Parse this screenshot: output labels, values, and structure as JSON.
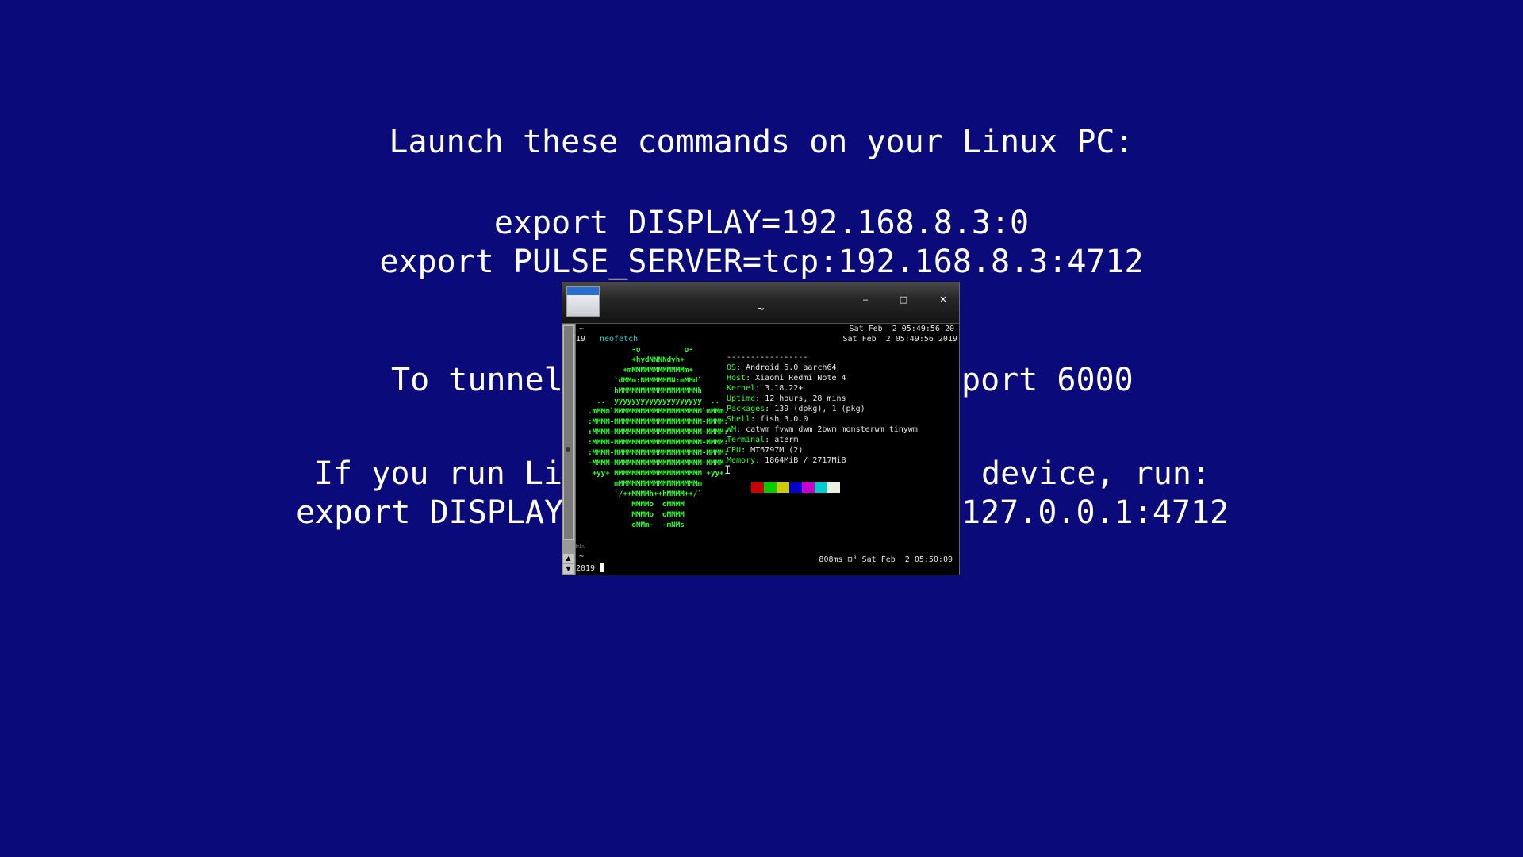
{
  "background": {
    "color": "#0a0a7a",
    "lines": [
      "Launch these commands on your Linux PC:",
      "export DISPLAY=192.168.8.3:0",
      "export PULSE_SERVER=tcp:192.168.8.3:4712",
      "To tunnel",
      "port 6000",
      "If you run Li",
      "device, run:",
      "export DISPLAY",
      "127.0.0.1:4712"
    ]
  },
  "window": {
    "title": "~",
    "buttons": {
      "minimize": "‒",
      "maximize": "□",
      "close": "✕"
    },
    "scroll_up": "▲",
    "scroll_down": "▼"
  },
  "terminal": {
    "prompt1_dir": "~",
    "prompt1_num": "19",
    "prompt1_cmd": "neofetch",
    "right_time1": "Sat Feb  2 05:49:56 20",
    "right_time2": "Sat Feb  2 05:49:56 2019",
    "ascii_art": "            -o          o-\n            +hydNNNNdyh+\n          +mMMMMMMMMMMMMm+\n        `dMMm:NMMMMMMN:mMMd`\n        hMMMMMMMMMMMMMMMMMMh\n    ..  yyyyyyyyyyyyyyyyyyyy  ..\n  .mMMm`MMMMMMMMMMMMMMMMMMMM`mMMm.\n  :MMMM-MMMMMMMMMMMMMMMMMMMM-MMMM:\n  :MMMM-MMMMMMMMMMMMMMMMMMMM-MMMM:\n  :MMMM-MMMMMMMMMMMMMMMMMMMM-MMMM:\n  :MMMM-MMMMMMMMMMMMMMMMMMMM-MMMM:\n  -MMMM-MMMMMMMMMMMMMMMMMMMM-MMMM-\n   +yy+ MMMMMMMMMMMMMMMMMMMM +yy+\n        mMMMMMMMMMMMMMMMMMMm\n        `/++MMMMh++hMMMM++/`\n            MMMMo  oMMMM\n            MMMMo  oMMMM\n            oNMm-  -mNMs",
    "info_separator": "-----------------",
    "info": [
      {
        "label": "OS",
        "value": "Android 6.0 aarch64"
      },
      {
        "label": "Host",
        "value": "Xiaomi Redmi Note 4"
      },
      {
        "label": "Kernel",
        "value": "3.18.22+"
      },
      {
        "label": "Uptime",
        "value": "12 hours, 28 mins"
      },
      {
        "label": "Packages",
        "value": "139 (dpkg), 1 (pkg)"
      },
      {
        "label": "Shell",
        "value": "fish 3.0.0"
      },
      {
        "label": "WM",
        "value": "catwm fvwm dwm 2bwm monsterwm tinywm"
      },
      {
        "label": "Terminal",
        "value": "aterm"
      },
      {
        "label": "CPU",
        "value": "MT6797M (2)"
      },
      {
        "label": "Memory",
        "value": "1864MiB / 2717MiB"
      }
    ],
    "swatch_colors": [
      "#000000",
      "#cc0000",
      "#00cc00",
      "#cccc00",
      "#0000cc",
      "#cc00cc",
      "#00cccc",
      "#eeeedd"
    ],
    "bottom_glyph": "⊡⊡",
    "prompt2_dir": "~",
    "prompt2_num": "2019",
    "bottom_status": "808ms ⊡⁰ Sat Feb  2 05:50:09"
  },
  "colors": {
    "accent_green": "#33ff33",
    "cyan": "#2ad0d0"
  }
}
